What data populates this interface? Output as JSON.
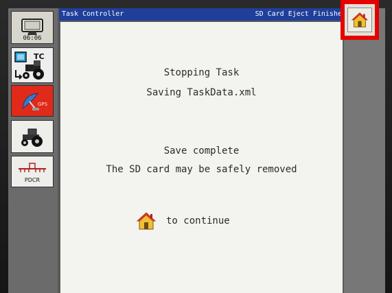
{
  "title_bar": {
    "app_title": "Task Controller",
    "status": "SD Card Eject Finishe"
  },
  "left_softkeys": {
    "clock": "06:06",
    "tc_label": "TC",
    "gps_label": "GPS",
    "pdcr_label": "PDCR"
  },
  "messages": {
    "line1": "Stopping Task",
    "line2": "Saving TaskData.xml",
    "line3": "Save complete",
    "line4": "The SD card may be safely removed",
    "continue": "to continue"
  },
  "icons": {
    "home": "home-icon",
    "clock": "clock-icon",
    "task-controller": "tractor-tc-icon",
    "gps": "satellite-dish-icon",
    "tractor": "tractor-icon",
    "pdcr": "sprayer-boom-icon"
  },
  "colors": {
    "title_bar": "#1f3f9a",
    "highlight": "#e60000",
    "gps_key": "#e02a1a",
    "home_roof": "#d9302a",
    "home_wall": "#f0c030"
  }
}
